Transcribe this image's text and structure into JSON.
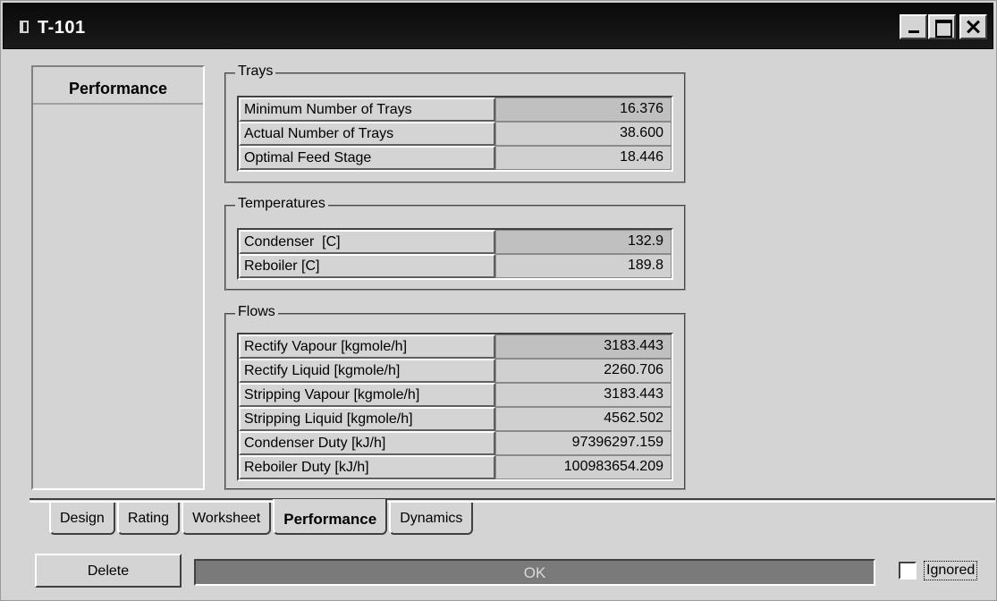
{
  "window": {
    "title": "T-101"
  },
  "sidebar": {
    "title": "Performance"
  },
  "groups": {
    "trays": {
      "label": "Trays",
      "rows": [
        {
          "label": "Minimum Number of Trays",
          "value": "16.376"
        },
        {
          "label": "Actual Number of Trays",
          "value": "38.600"
        },
        {
          "label": "Optimal Feed Stage",
          "value": "18.446"
        }
      ]
    },
    "temperatures": {
      "label": "Temperatures",
      "rows": [
        {
          "label": "Condenser  [C]",
          "value": "132.9"
        },
        {
          "label": "Reboiler [C]",
          "value": "189.8"
        }
      ]
    },
    "flows": {
      "label": "Flows",
      "rows": [
        {
          "label": "Rectify Vapour [kgmole/h]",
          "value": "3183.443"
        },
        {
          "label": "Rectify Liquid [kgmole/h]",
          "value": "2260.706"
        },
        {
          "label": "Stripping Vapour [kgmole/h]",
          "value": "3183.443"
        },
        {
          "label": "Stripping Liquid [kgmole/h]",
          "value": "4562.502"
        },
        {
          "label": "Condenser Duty [kJ/h]",
          "value": "97396297.159"
        },
        {
          "label": "Reboiler Duty [kJ/h]",
          "value": "100983654.209"
        }
      ]
    }
  },
  "tabs": [
    {
      "label": "Design",
      "active": false
    },
    {
      "label": "Rating",
      "active": false
    },
    {
      "label": "Worksheet",
      "active": false
    },
    {
      "label": "Performance",
      "active": true
    },
    {
      "label": "Dynamics",
      "active": false
    }
  ],
  "footer": {
    "delete_label": "Delete",
    "status_text": "OK",
    "ignored_label": "Ignored",
    "ignored_checked": false
  }
}
